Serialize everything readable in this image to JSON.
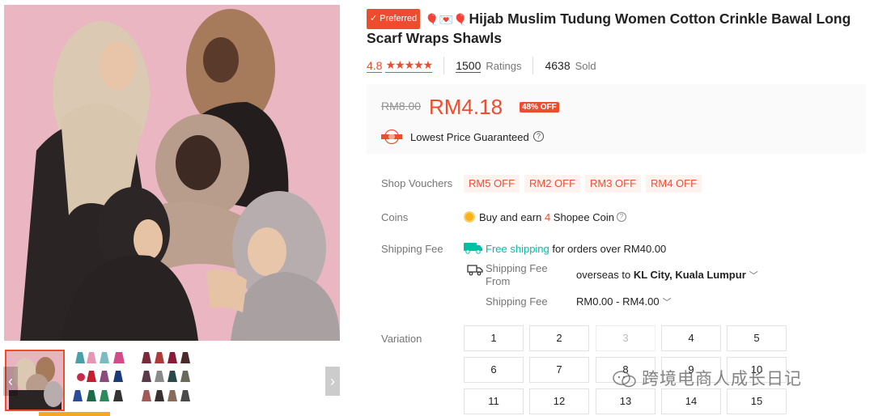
{
  "product": {
    "preferred_badge": "Preferred",
    "title_emoji": "🎈💌🎈",
    "title": "Hijab Muslim Tudung Women Cotton Crinkle Bawal Long Scarf Wraps Shawls"
  },
  "stats": {
    "rating": "4.8",
    "stars": "★★★★★",
    "ratings_count": "1500",
    "ratings_label": "Ratings",
    "sold_count": "4638",
    "sold_label": "Sold"
  },
  "price": {
    "original": "RM8.00",
    "current": "RM4.18",
    "discount": "48% OFF",
    "guarantee": "Lowest Price Guaranteed",
    "help_icon": "?"
  },
  "vouchers": {
    "label": "Shop Vouchers",
    "items": [
      "RM5 OFF",
      "RM2 OFF",
      "RM3 OFF",
      "RM4 OFF"
    ]
  },
  "coins": {
    "label": "Coins",
    "text_before": "Buy and earn ",
    "amount": "4",
    "text_after": " Shopee Coin",
    "help_icon": "?"
  },
  "shipping": {
    "label": "Shipping Fee",
    "free_label": "Free shipping",
    "free_condition": " for orders over RM40.00",
    "from_label": "Shipping Fee From",
    "from_value": "overseas",
    "to_word": " to ",
    "destination": "KL City, Kuala Lumpur",
    "fee_label": "Shipping Fee",
    "fee_range": "RM0.00 - RM4.00",
    "chevron": "﹀"
  },
  "variation": {
    "label": "Variation",
    "options": [
      "1",
      "2",
      "3",
      "4",
      "5",
      "6",
      "7",
      "8",
      "9",
      "10",
      "11",
      "12",
      "13",
      "14",
      "15"
    ],
    "disabled": [
      "3"
    ]
  },
  "gallery": {
    "prev_arrow": "‹",
    "next_arrow": "›"
  },
  "watermark": {
    "text": "跨境电商人成长日记"
  },
  "colors": {
    "accent": "#ee4d2d",
    "free_shipping": "#00bfa5",
    "coin": "#f6b11b"
  }
}
